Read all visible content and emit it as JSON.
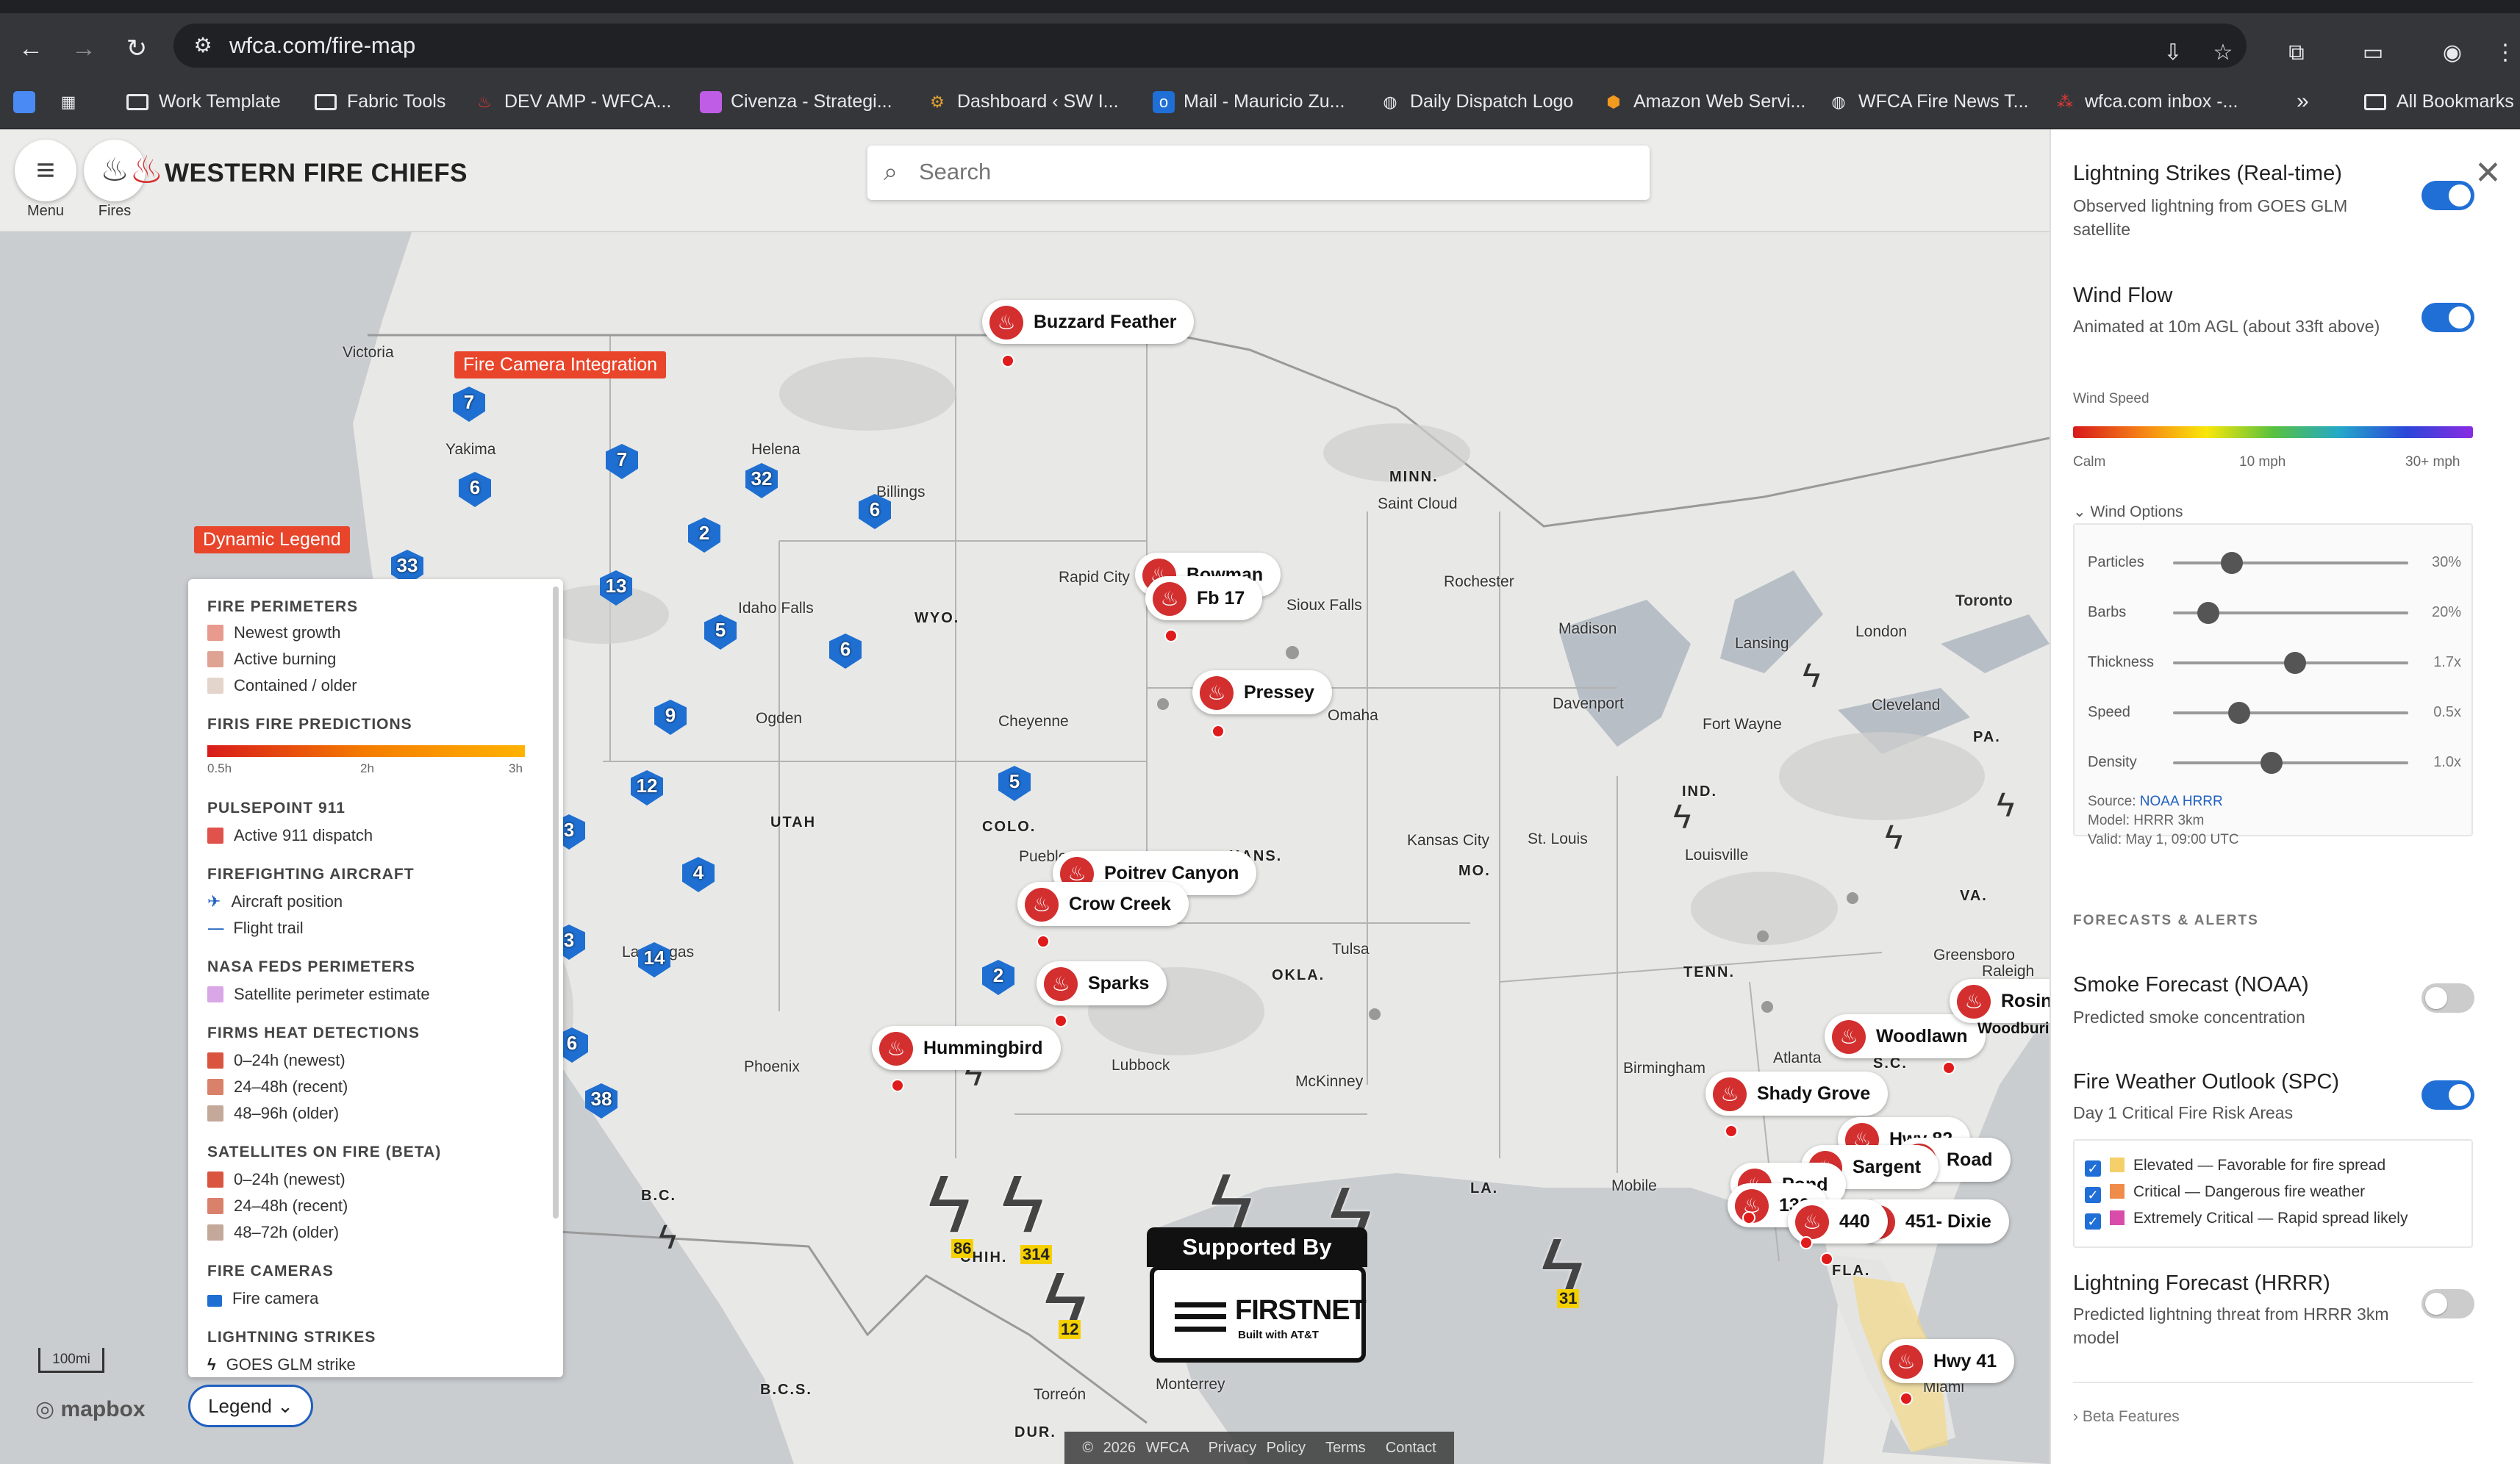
{
  "browser": {
    "url": "wfca.com/fire-map",
    "bookmarks": [
      {
        "label": "Work Template",
        "icon": "folder-icon"
      },
      {
        "label": "Fabric Tools",
        "icon": "folder-icon"
      },
      {
        "label": "DEV AMP - WFCA...",
        "icon": "flame-icon"
      },
      {
        "label": "Civenza - Strategi...",
        "icon": "app-icon"
      },
      {
        "label": "Dashboard ‹ SW I...",
        "icon": "gear-icon"
      },
      {
        "label": "Mail - Mauricio Zu...",
        "icon": "outlook-icon"
      },
      {
        "label": "Daily Dispatch Logo",
        "icon": "globe-icon"
      },
      {
        "label": "Amazon Web Servi...",
        "icon": "aws-icon"
      },
      {
        "label": "WFCA Fire News T...",
        "icon": "globe-icon"
      },
      {
        "label": "wfca.com inbox -...",
        "icon": "app-icon"
      }
    ],
    "more": "»",
    "all_bookmarks": "All Bookmarks"
  },
  "header": {
    "menu_label": "Menu",
    "fires_label": "Fires",
    "brand": "WESTERN FIRE CHIEFS",
    "search_placeholder": "Search"
  },
  "map": {
    "fire_camera_tag": "Fire Camera Integration",
    "dynamic_legend_tag": "Dynamic Legend",
    "fires": [
      {
        "name": "Buzzard Feather"
      },
      {
        "name": "Bowman"
      },
      {
        "name": "Fb 17"
      },
      {
        "name": "Pressey"
      },
      {
        "name": "Poitrev Canyon"
      },
      {
        "name": "Crow Creek"
      },
      {
        "name": "Sparks"
      },
      {
        "name": "Hummingbird"
      },
      {
        "name": "Woodlawn"
      },
      {
        "name": "Rosin"
      },
      {
        "name": "Woodburi"
      },
      {
        "name": "Shady Grove"
      },
      {
        "name": "Hwy 82"
      },
      {
        "name": "Sargent"
      },
      {
        "name": "Road"
      },
      {
        "name": "130"
      },
      {
        "name": "Pond"
      },
      {
        "name": "440"
      },
      {
        "name": "451- Dixie"
      },
      {
        "name": "Hwy 41"
      }
    ],
    "cameras": [
      "7",
      "7",
      "6",
      "32",
      "6",
      "2",
      "33",
      "13",
      "5",
      "6",
      "9",
      "5",
      "12",
      "3",
      "4",
      "2",
      "14",
      "3",
      "6",
      "38"
    ],
    "lightning_counts": [
      "86",
      "314",
      "12",
      "31"
    ],
    "cities": [
      "Victoria",
      "Yakima",
      "Helena",
      "Billings",
      "Idaho Falls",
      "Ogden",
      "Cheyenne",
      "Rapid City",
      "Sioux Falls",
      "Saint Cloud",
      "Rochester",
      "Omaha",
      "Davenport",
      "Madison",
      "Lansing",
      "London",
      "Toronto",
      "Cleveland",
      "Fort Wayne",
      "Kansas City",
      "St. Louis",
      "Louisville",
      "Tulsa",
      "Lubbock",
      "McKinney",
      "Phoenix",
      "Las Vegas",
      "Birmingham",
      "Atlanta",
      "Mobile",
      "Greensboro",
      "Raleigh",
      "Torreón",
      "Monterrey",
      "Miami",
      "Pueblo"
    ],
    "states": [
      "MINN.",
      "WYO.",
      "UTAH",
      "COLO.",
      "KANS.",
      "MO.",
      "OKLA.",
      "IND.",
      "TENN.",
      "LA.",
      "FLA.",
      "VA.",
      "PA.",
      "S.C.",
      "B.C.",
      "B.C.S.",
      "CHIH.",
      "DUR."
    ],
    "scale": "100mi",
    "mapbox": "mapbox",
    "supported_by": "Supported By",
    "firstnet": "FIRSTNET",
    "firstnet_sub": "Built with AT&T",
    "footer": [
      "© 2026 WFCA",
      "Privacy Policy",
      "Terms",
      "Contact"
    ]
  },
  "legend": {
    "button": "Legend",
    "sections": [
      {
        "title": "FIRE PERIMETERS",
        "items": [
          {
            "label": "Newest growth",
            "color": "#e89a8e"
          },
          {
            "label": "Active burning",
            "color": "#dfa393"
          },
          {
            "label": "Contained / older",
            "color": "#e3d5cb"
          }
        ]
      },
      {
        "title": "FIRIS FIRE PREDICTIONS",
        "items": [],
        "scale": [
          "0.5h",
          "2h",
          "3h"
        ]
      },
      {
        "title": "PULSEPOINT 911",
        "items": [
          {
            "label": "Active 911 dispatch",
            "color": "#e0524c"
          }
        ]
      },
      {
        "title": "FIREFIGHTING AIRCRAFT",
        "items": [
          {
            "label": "Aircraft position",
            "icon": "airplane-icon"
          },
          {
            "label": "Flight trail",
            "icon": "dashed-line-icon"
          }
        ]
      },
      {
        "title": "NASA FEDS PERIMETERS",
        "items": [
          {
            "label": "Satellite perimeter estimate",
            "color": "#d9a6e6"
          }
        ]
      },
      {
        "title": "FIRMS HEAT DETECTIONS",
        "items": [
          {
            "label": "0–24h (newest)",
            "color": "#d9553f"
          },
          {
            "label": "24–48h (recent)",
            "color": "#d9816b"
          },
          {
            "label": "48–96h (older)",
            "color": "#c4a89a"
          }
        ]
      },
      {
        "title": "SATELLITES ON FIRE (BETA)",
        "items": [
          {
            "label": "0–24h (newest)",
            "color": "#d9553f"
          },
          {
            "label": "24–48h (recent)",
            "color": "#d9816b"
          },
          {
            "label": "48–72h (older)",
            "color": "#c4a89a"
          }
        ]
      },
      {
        "title": "FIRE CAMERAS",
        "items": [
          {
            "label": "Fire camera",
            "icon": "camera-icon"
          }
        ]
      },
      {
        "title": "LIGHTNING STRIKES",
        "items": [
          {
            "label": "GOES GLM strike",
            "icon": "lightning-icon"
          }
        ]
      }
    ]
  },
  "sidebar": {
    "lightning": {
      "title": "Lightning Strikes (Real-time)",
      "desc": "Observed lightning from GOES GLM satellite",
      "on": true
    },
    "wind": {
      "title": "Wind Flow",
      "desc": "Animated at 10m AGL (about 33ft above)",
      "on": true
    },
    "wind_speed_label": "Wind Speed",
    "wind_scale": [
      "Calm",
      "10 mph",
      "30+ mph"
    ],
    "wind_options_label": "Wind Options",
    "sliders": [
      {
        "label": "Particles",
        "value": "30%",
        "pos": 0.25
      },
      {
        "label": "Barbs",
        "value": "20%",
        "pos": 0.15
      },
      {
        "label": "Thickness",
        "value": "1.7x",
        "pos": 0.52
      },
      {
        "label": "Speed",
        "value": "0.5x",
        "pos": 0.28
      },
      {
        "label": "Density",
        "value": "1.0x",
        "pos": 0.42
      }
    ],
    "source_prefix": "Source:",
    "source_link": "NOAA HRRR",
    "model": "Model: HRRR 3km",
    "valid": "Valid: May 1, 09:00 UTC",
    "forecasts_heading": "FORECASTS & ALERTS",
    "smoke": {
      "title": "Smoke Forecast (NOAA)",
      "desc": "Predicted smoke concentration",
      "on": false
    },
    "fire_weather": {
      "title": "Fire Weather Outlook (SPC)",
      "desc": "Day 1 Critical Fire Risk Areas",
      "on": true
    },
    "outlook_items": [
      {
        "label": "Elevated — Favorable for fire spread",
        "color": "#f5cf6a"
      },
      {
        "label": "Critical — Dangerous fire weather",
        "color": "#f08c4a"
      },
      {
        "label": "Extremely Critical — Rapid spread likely",
        "color": "#d94ca9"
      }
    ],
    "lightning_forecast": {
      "title": "Lightning Forecast (HRRR)",
      "desc": "Predicted lightning threat from HRRR 3km model",
      "on": false
    },
    "beta_features": "Beta Features"
  }
}
